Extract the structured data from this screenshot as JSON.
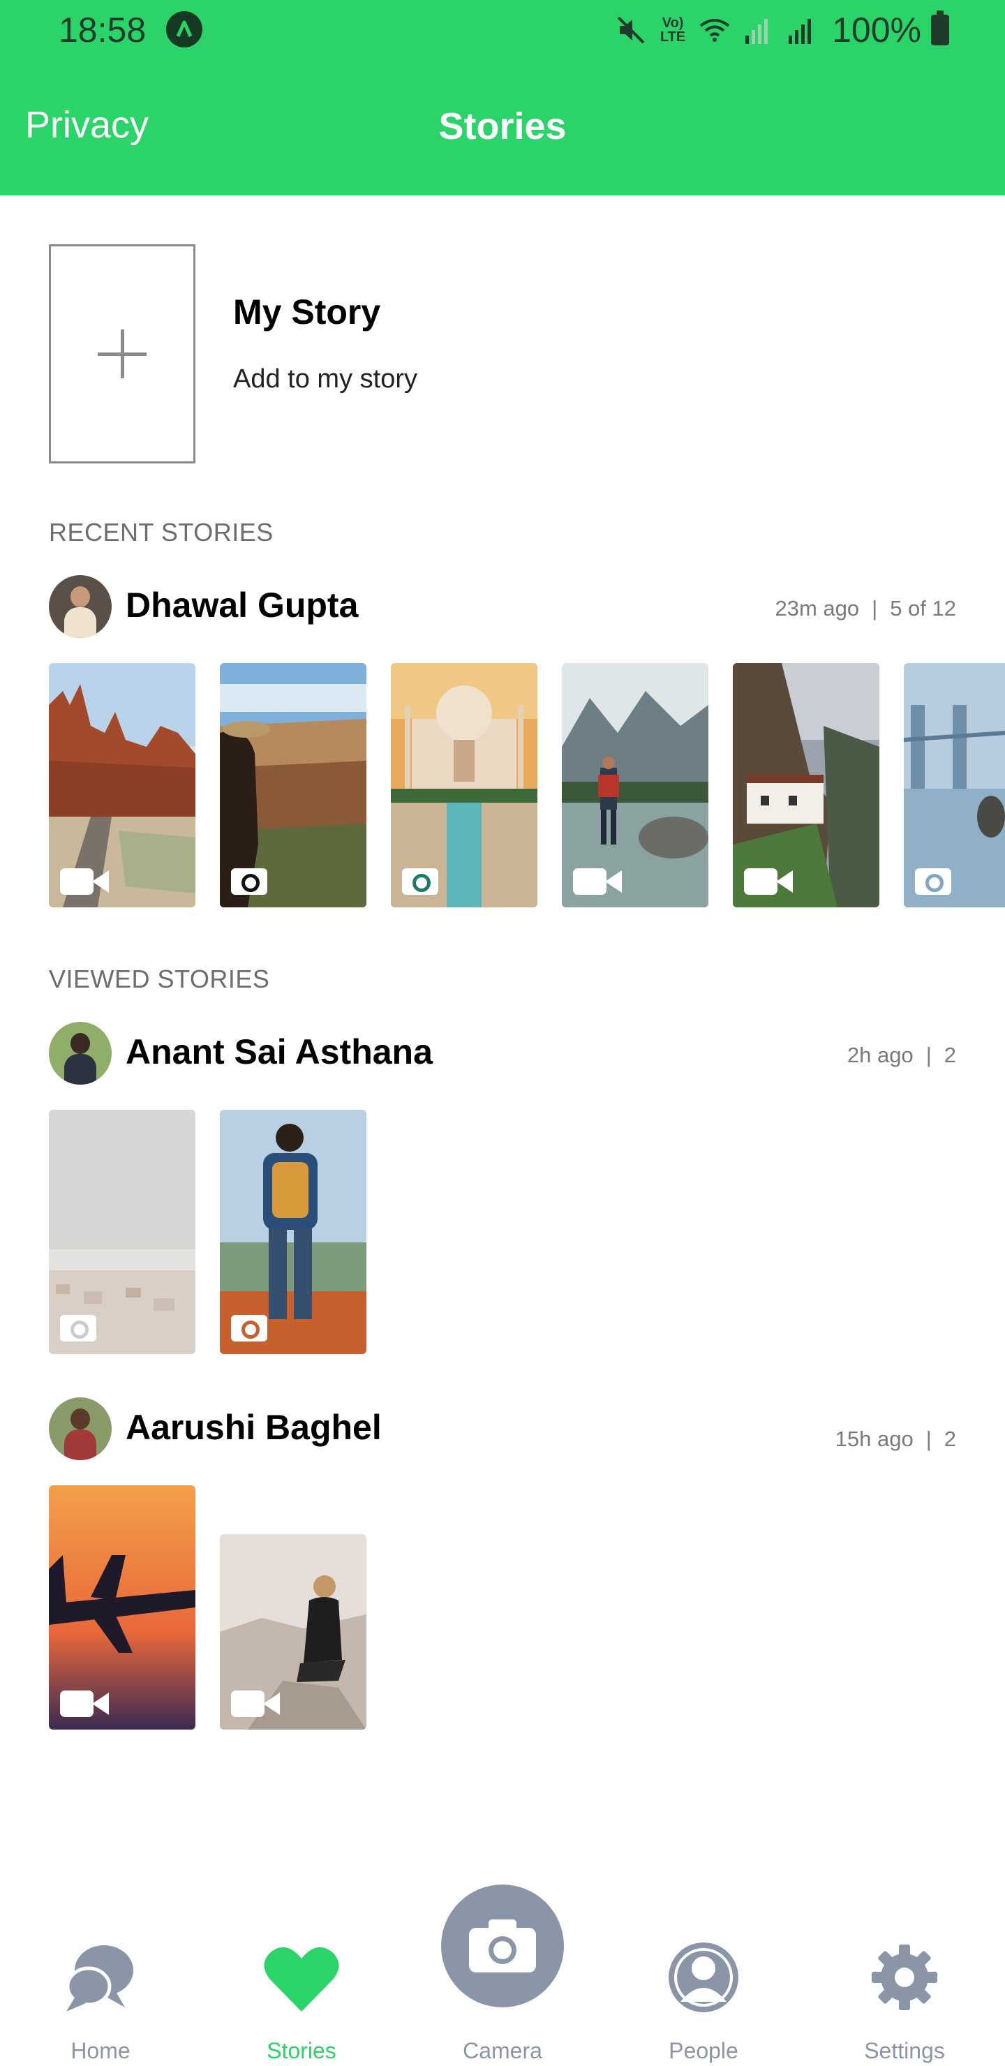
{
  "status_bar": {
    "time": "18:58",
    "network": "Vo) LTE",
    "battery": "100%"
  },
  "header": {
    "privacy_label": "Privacy",
    "title": "Stories",
    "color": "#2AD469"
  },
  "my_story": {
    "title": "My Story",
    "subtitle": "Add to my story"
  },
  "recent": {
    "label": "RECENT STORIES",
    "user": {
      "name": "Dhawal Gupta",
      "time": "23m ago",
      "count": "5 of 12"
    },
    "stories": [
      {
        "scene": "red-rock-desert-road",
        "media": "video-icon"
      },
      {
        "scene": "grand-canyon-person",
        "media": "camera-icon"
      },
      {
        "scene": "taj-mahal",
        "media": "camera-icon"
      },
      {
        "scene": "mountain-lake-hiker",
        "media": "video-icon"
      },
      {
        "scene": "cliff-monastery",
        "media": "video-icon"
      },
      {
        "scene": "bridge-reflection",
        "media": "camera-icon"
      }
    ]
  },
  "viewed": {
    "label": "VIEWED STORIES",
    "users": [
      {
        "name": "Anant Sai Asthana",
        "time": "2h ago",
        "count": "2",
        "stories": [
          {
            "scene": "hazy-city",
            "media": "camera-icon"
          },
          {
            "scene": "backpacker-view",
            "media": "camera-icon"
          }
        ]
      },
      {
        "name": "Aarushi Baghel",
        "time": "15h ago",
        "count": "2",
        "stories": [
          {
            "scene": "airplane-sunset",
            "media": "video-icon"
          },
          {
            "scene": "woman-on-cliff",
            "media": "video-icon"
          }
        ]
      }
    ]
  },
  "bottom_nav": {
    "items": [
      {
        "label": "Home",
        "icon": "chat-bubbles-icon"
      },
      {
        "label": "Stories",
        "icon": "heart-icon"
      },
      {
        "label": "Camera",
        "icon": "camera-icon"
      },
      {
        "label": "People",
        "icon": "person-icon"
      },
      {
        "label": "Settings",
        "icon": "gear-icon"
      }
    ],
    "active_color": "#2AD469",
    "inactive_color": "#8a96a8"
  }
}
